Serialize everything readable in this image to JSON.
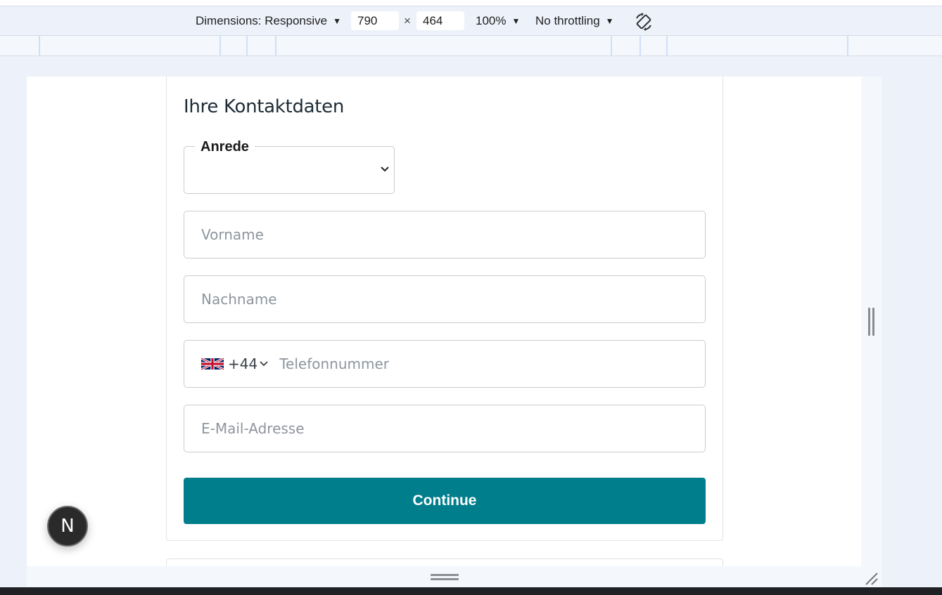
{
  "devtools": {
    "dimensions_label": "Dimensions: Responsive",
    "width_value": "790",
    "times_symbol": "×",
    "height_value": "464",
    "zoom_label": "100%",
    "throttling_label": "No throttling",
    "icons": {
      "rotate": "rotate-icon",
      "dropdown": "triangle-down-icon"
    }
  },
  "form": {
    "title": "Ihre Kontaktdaten",
    "salutation_legend": "Anrede",
    "first_name_placeholder": "Vorname",
    "last_name_placeholder": "Nachname",
    "phone_country_code": "+44",
    "phone_country_flag": "uk-flag-icon",
    "phone_placeholder": "Telefonnummer",
    "email_placeholder": "E-Mail-Adresse",
    "continue_label": "Continue"
  },
  "badge": {
    "letter": "N"
  },
  "colors": {
    "accent": "#017e8b",
    "page_bg": "#edf1fa"
  }
}
